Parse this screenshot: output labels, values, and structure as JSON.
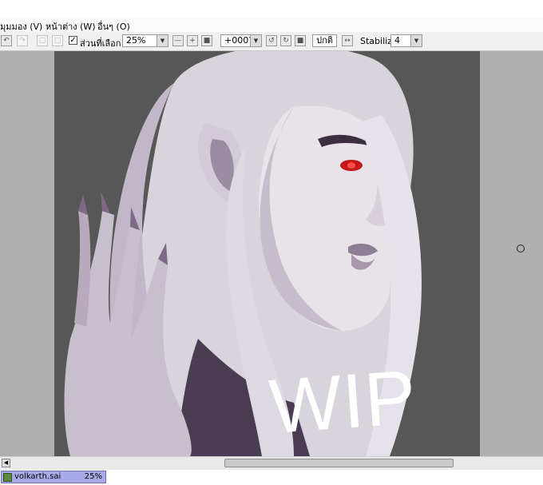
{
  "menu": {
    "items": [
      {
        "label": "มุมมอง (V)"
      },
      {
        "label": "หน้าต่าง (W)"
      },
      {
        "label": "อื่นๆ (O)"
      }
    ]
  },
  "toolbar": {
    "selection_label": "ส่วนที่เลือก",
    "selection_checked": true,
    "zoom_value": "25%",
    "rotation_value": "+000?",
    "normal_label": "ปกติ",
    "stabilize_label": "Stabilize",
    "stabilize_value": "4"
  },
  "canvas": {
    "overlay_text": "WIP",
    "background_color": "#575757",
    "workspace_color": "#b0b0b0"
  },
  "statusbar": {
    "file_name": "volkarth.sai",
    "file_zoom": "25%",
    "tab_color": "#a9a9e8"
  }
}
